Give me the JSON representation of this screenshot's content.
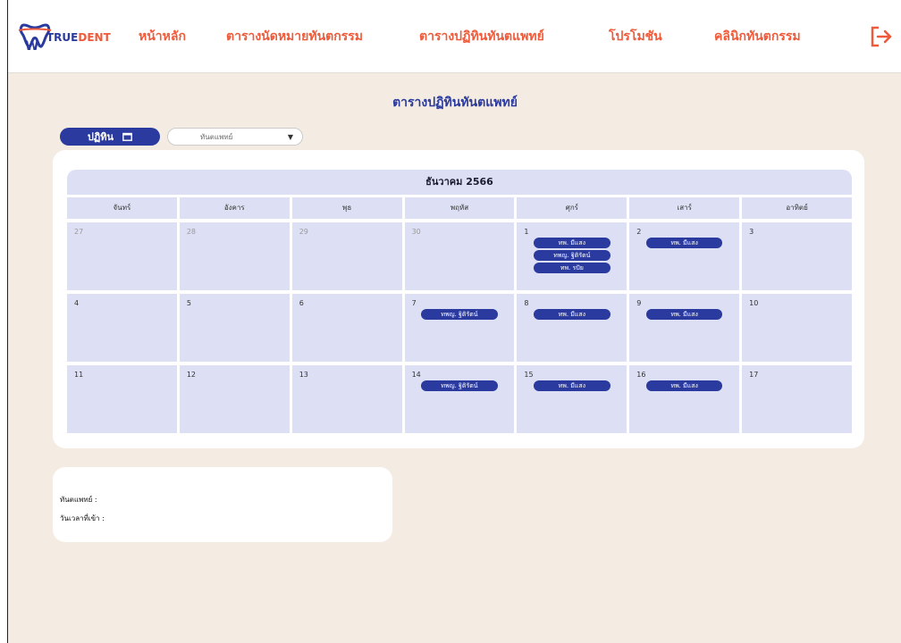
{
  "nav": {
    "home": "หน้าหลัก",
    "appointments": "ตารางนัดหมายทันตกรรม",
    "dentist_schedule": "ตารางปฏิทินทันตแพทย์",
    "promotions": "โปรโมชัน",
    "clinics": "คลินิกทันตกรรม"
  },
  "logo": {
    "true": "TRUE",
    "dent": "DENT"
  },
  "page": {
    "title": "ตารางปฏิทินทันตแพทย์",
    "schedule_button": "ปฏิทิน",
    "dentist_select_placeholder": "ทันตแพทย์"
  },
  "calendar": {
    "month_title": "ธันวาคม 2566",
    "weekdays": [
      "จันทร์",
      "อังคาร",
      "พุธ",
      "พฤหัส",
      "ศุกร์",
      "เสาร์",
      "อาทิตย์"
    ],
    "weeks": [
      [
        {
          "day": "27",
          "muted": true,
          "events": []
        },
        {
          "day": "28",
          "muted": true,
          "events": []
        },
        {
          "day": "29",
          "muted": true,
          "events": []
        },
        {
          "day": "30",
          "muted": true,
          "events": []
        },
        {
          "day": "1",
          "events": [
            "ทพ. มีแสง",
            "ทพญ. ฐิติรัตน์",
            "ทพ. รปัย"
          ]
        },
        {
          "day": "2",
          "events": [
            "ทพ. มีแสง"
          ]
        },
        {
          "day": "3",
          "events": []
        }
      ],
      [
        {
          "day": "4",
          "events": []
        },
        {
          "day": "5",
          "events": []
        },
        {
          "day": "6",
          "events": []
        },
        {
          "day": "7",
          "events": [
            "ทพญ. ฐิติรัตน์"
          ]
        },
        {
          "day": "8",
          "events": [
            "ทพ. มีแสง"
          ]
        },
        {
          "day": "9",
          "events": [
            "ทพ. มีแสง"
          ]
        },
        {
          "day": "10",
          "events": []
        }
      ],
      [
        {
          "day": "11",
          "events": []
        },
        {
          "day": "12",
          "events": []
        },
        {
          "day": "13",
          "events": []
        },
        {
          "day": "14",
          "events": [
            "ทพญ. ฐิติรัตน์"
          ]
        },
        {
          "day": "15",
          "events": [
            "ทพ. มีแสง"
          ]
        },
        {
          "day": "16",
          "events": [
            "ทพ. มีแสง"
          ]
        },
        {
          "day": "17",
          "events": []
        }
      ]
    ]
  },
  "info": {
    "dentist_label": "ทันตแพทย์ :",
    "time_label": "วันเวลาที่เข้า :"
  },
  "colors": {
    "brand_blue": "#2a3a9e",
    "brand_orange": "#ef5b3a",
    "background": "#f4ece2",
    "cell": "#dde0f5"
  }
}
